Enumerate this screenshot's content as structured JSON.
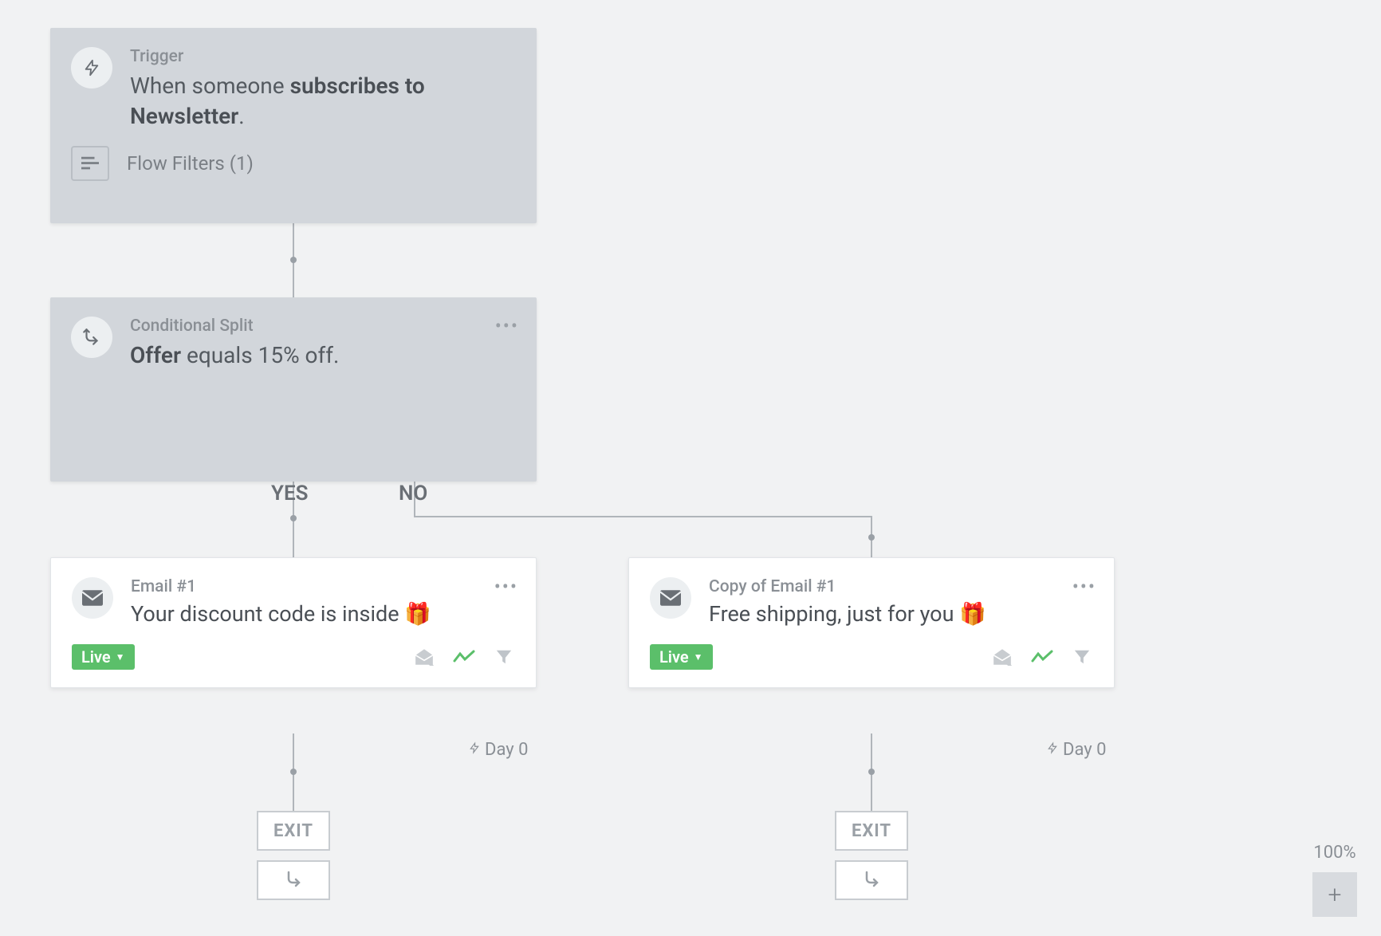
{
  "trigger": {
    "label": "Trigger",
    "desc_prefix": "When someone ",
    "desc_bold": "subscribes to Newsletter",
    "desc_suffix": ".",
    "filters_label": "Flow Filters (1)"
  },
  "split": {
    "label": "Conditional Split",
    "desc_prefix": "Offer ",
    "desc_rest": "equals 15% off.",
    "yes_label": "YES",
    "no_label": "NO"
  },
  "emails": [
    {
      "label": "Email #1",
      "subject": "Your discount code is inside 🎁",
      "status": "Live",
      "day": "Day 0"
    },
    {
      "label": "Copy of Email #1",
      "subject": "Free shipping, just for you 🎁",
      "status": "Live",
      "day": "Day 0"
    }
  ],
  "exit_label": "EXIT",
  "zoom_label": "100%",
  "zoom_in": "+"
}
